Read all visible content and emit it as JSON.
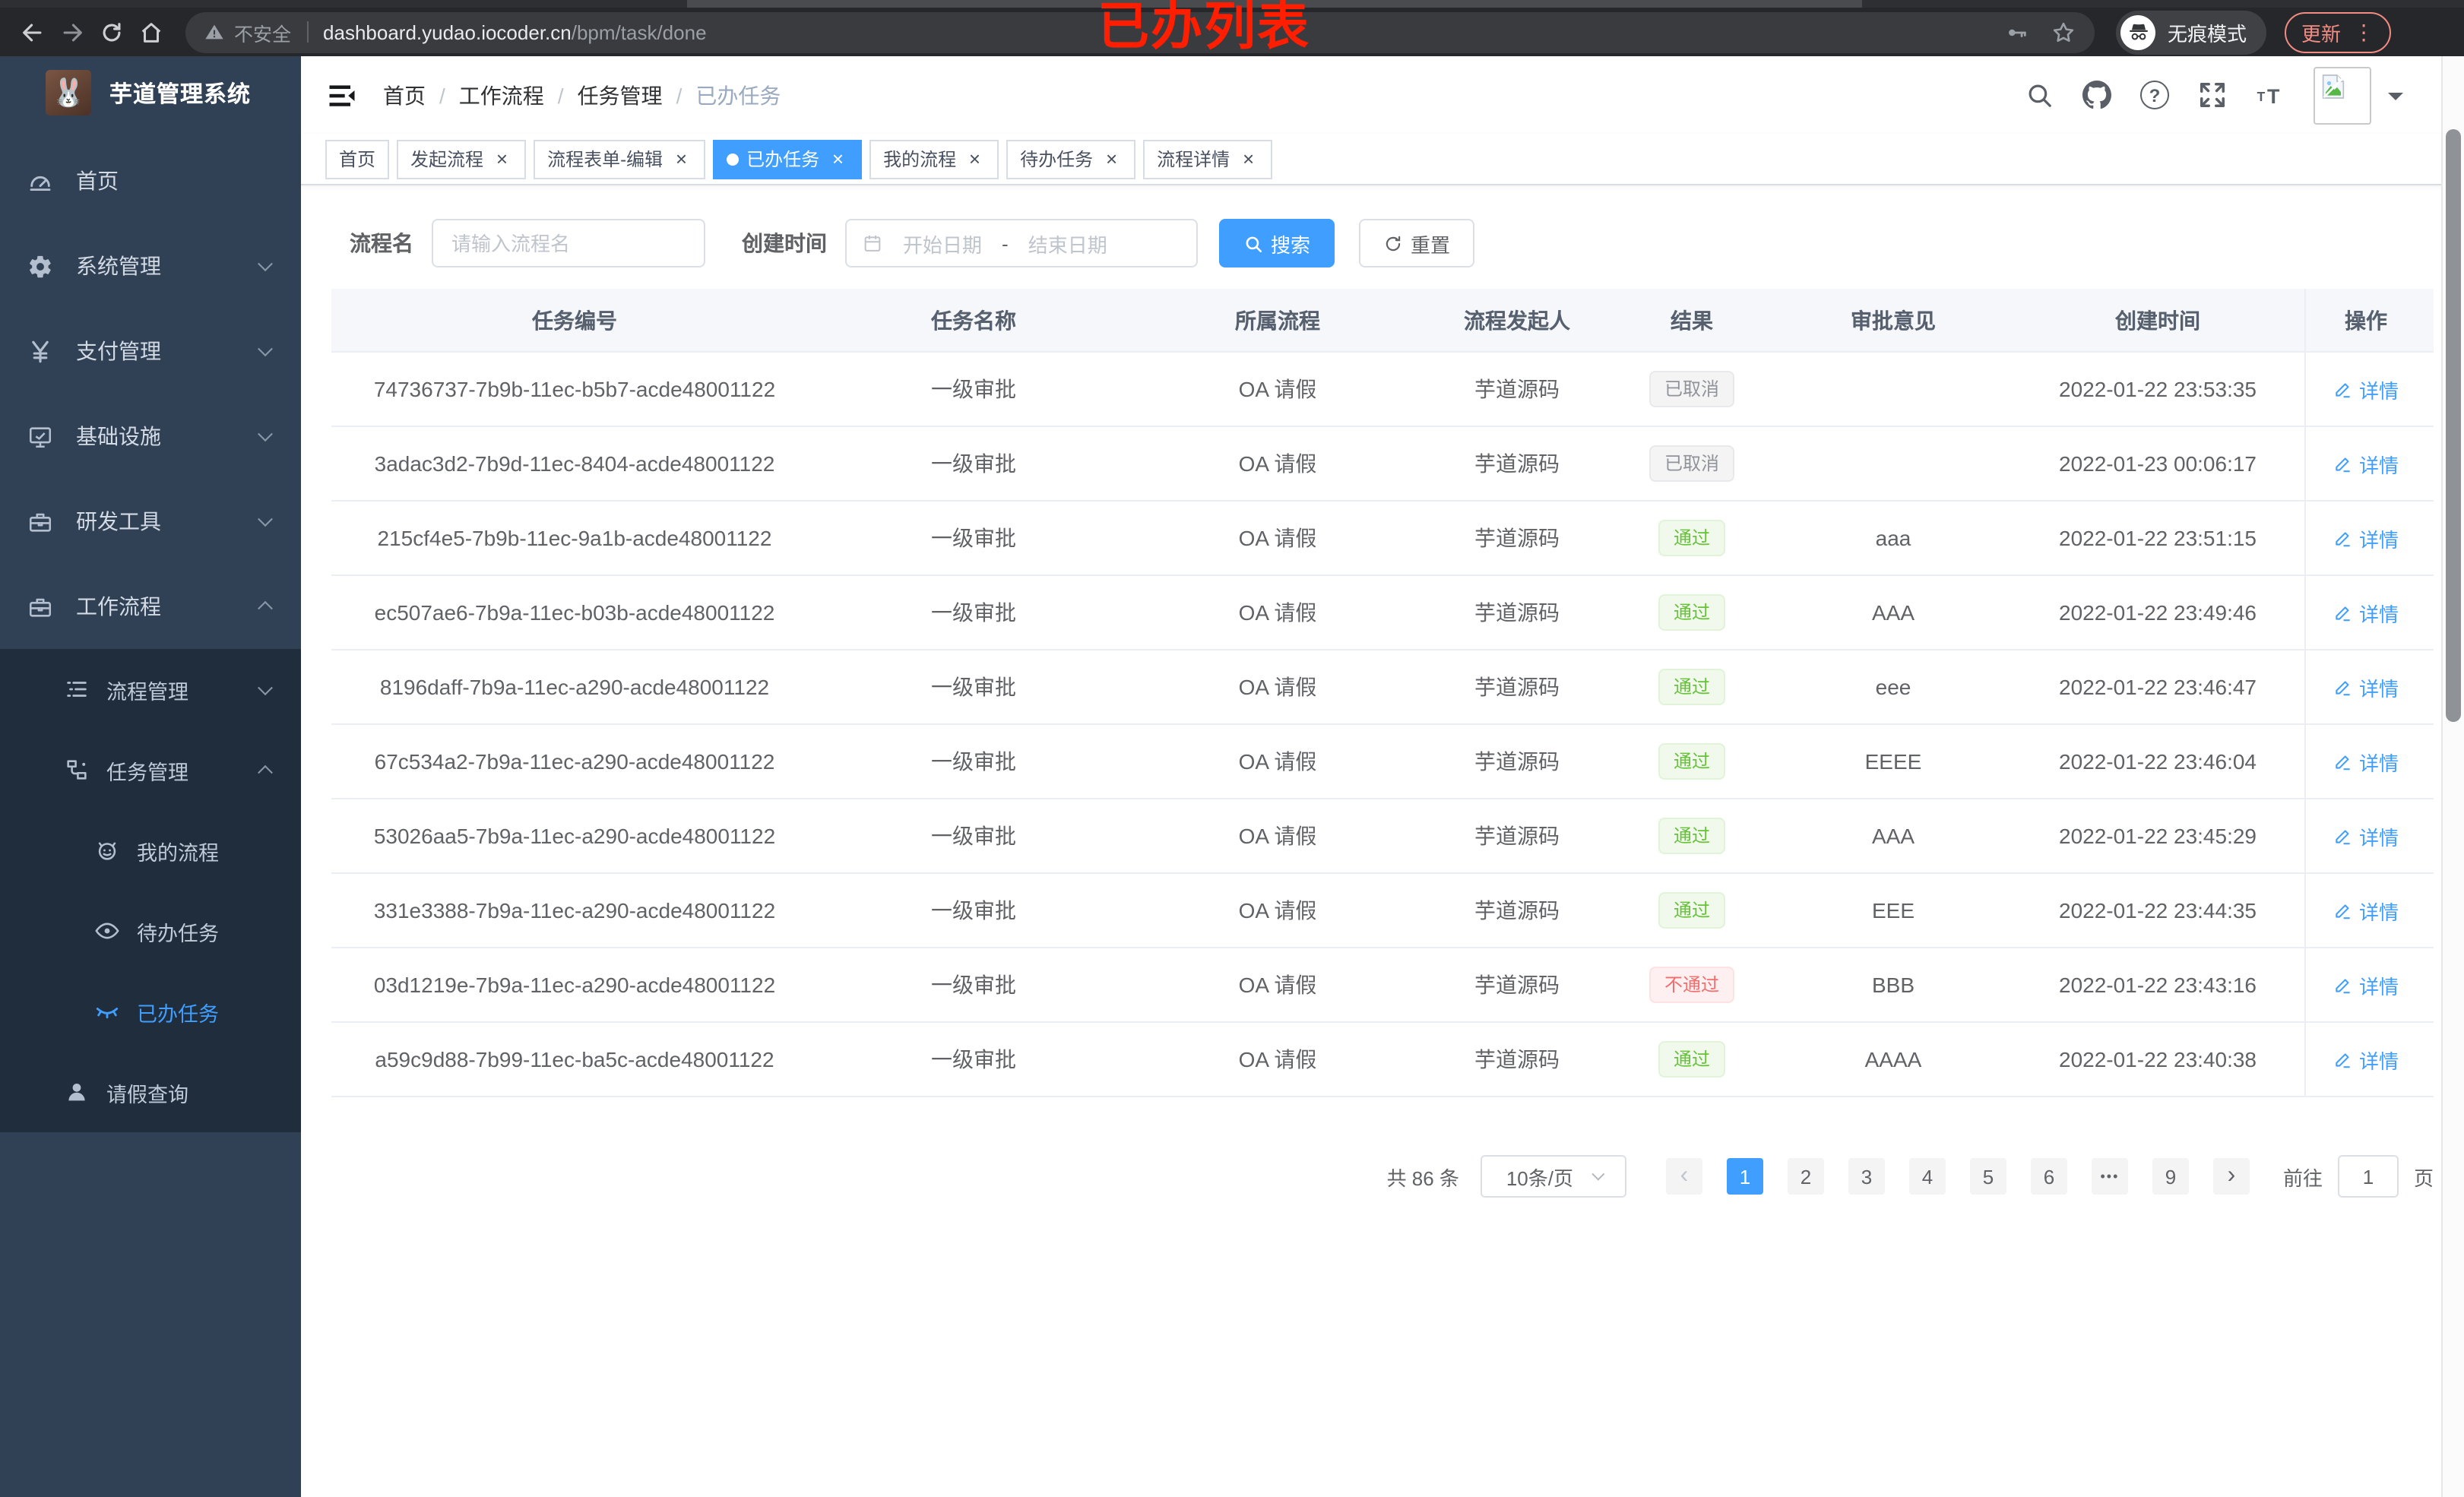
{
  "browser": {
    "security_label": "不安全",
    "url_host": "dashboard.yudao.iocoder.cn",
    "url_path": "/bpm/task/done",
    "incognito_label": "无痕模式",
    "update_label": "更新",
    "toolbar_icons": [
      "back-icon",
      "forward-icon",
      "reload-icon",
      "home-icon",
      "warning-icon",
      "key-icon",
      "star-icon",
      "incognito-icon",
      "menu-dots-icon"
    ]
  },
  "annotation": "已办列表",
  "sidebar": {
    "title": "芋道管理系统",
    "logo_icon": "rabbit-logo",
    "items": [
      {
        "label": "首页",
        "icon": "dashboard",
        "cls": "lvl1"
      },
      {
        "label": "系统管理",
        "icon": "gear",
        "cls": "lvl1",
        "arrow": "down"
      },
      {
        "label": "支付管理",
        "icon": "yen",
        "cls": "lvl1",
        "arrow": "down"
      },
      {
        "label": "基础设施",
        "icon": "monitor",
        "cls": "lvl1",
        "arrow": "down"
      },
      {
        "label": "研发工具",
        "icon": "toolbox",
        "cls": "lvl1",
        "arrow": "down"
      },
      {
        "label": "工作流程",
        "icon": "briefcase",
        "cls": "lvl1",
        "arrow": "up"
      },
      {
        "label": "流程管理",
        "icon": "list",
        "cls": "lvl2 dark",
        "arrow": "down"
      },
      {
        "label": "任务管理",
        "icon": "flow",
        "cls": "lvl2 dark",
        "arrow": "up"
      },
      {
        "label": "我的流程",
        "icon": "robot",
        "cls": "lvl3 dark"
      },
      {
        "label": "待办任务",
        "icon": "eye",
        "cls": "lvl3 dark"
      },
      {
        "label": "已办任务",
        "icon": "eye-closed",
        "cls": "lvl3 dark active"
      },
      {
        "label": "请假查询",
        "icon": "user",
        "cls": "lvl2 dark"
      }
    ]
  },
  "navbar": {
    "breadcrumb": [
      {
        "label": "首页",
        "sep": true
      },
      {
        "label": "工作流程",
        "sep": true
      },
      {
        "label": "任务管理",
        "sep": true
      },
      {
        "label": "已办任务",
        "cls": "current"
      }
    ],
    "icons": [
      "search-icon",
      "github-icon",
      "help-icon",
      "fullscreen-icon",
      "font-size-icon",
      "avatar",
      "caret-down-icon"
    ]
  },
  "tabs": [
    {
      "label": "首页"
    },
    {
      "label": "发起流程",
      "closable": true
    },
    {
      "label": "流程表单-编辑",
      "closable": true
    },
    {
      "label": "已办任务",
      "closable": true,
      "active": true,
      "cls": "active"
    },
    {
      "label": "我的流程",
      "closable": true
    },
    {
      "label": "待办任务",
      "closable": true
    },
    {
      "label": "流程详情",
      "closable": true
    }
  ],
  "filter": {
    "name_label": "流程名",
    "name_placeholder": "请输入流程名",
    "time_label": "创建时间",
    "start_placeholder": "开始日期",
    "range_separator": "-",
    "end_placeholder": "结束日期",
    "search_label": "搜索",
    "reset_label": "重置"
  },
  "table": {
    "headers": [
      "任务编号",
      "任务名称",
      "所属流程",
      "流程发起人",
      "结果",
      "审批意见",
      "创建时间",
      "操作"
    ],
    "action_label": "详情",
    "rows": [
      {
        "id": "74736737-7b9b-11ec-b5b7-acde48001122",
        "name": "一级审批",
        "process": "OA 请假",
        "starter": "芋道源码",
        "result": "已取消",
        "result_type": "info",
        "comment": "",
        "created": "2022-01-22 23:53:35"
      },
      {
        "id": "3adac3d2-7b9d-11ec-8404-acde48001122",
        "name": "一级审批",
        "process": "OA 请假",
        "starter": "芋道源码",
        "result": "已取消",
        "result_type": "info",
        "comment": "",
        "created": "2022-01-23 00:06:17"
      },
      {
        "id": "215cf4e5-7b9b-11ec-9a1b-acde48001122",
        "name": "一级审批",
        "process": "OA 请假",
        "starter": "芋道源码",
        "result": "通过",
        "result_type": "success",
        "comment": "aaa",
        "created": "2022-01-22 23:51:15"
      },
      {
        "id": "ec507ae6-7b9a-11ec-b03b-acde48001122",
        "name": "一级审批",
        "process": "OA 请假",
        "starter": "芋道源码",
        "result": "通过",
        "result_type": "success",
        "comment": "AAA",
        "created": "2022-01-22 23:49:46"
      },
      {
        "id": "8196daff-7b9a-11ec-a290-acde48001122",
        "name": "一级审批",
        "process": "OA 请假",
        "starter": "芋道源码",
        "result": "通过",
        "result_type": "success",
        "comment": "eee",
        "created": "2022-01-22 23:46:47"
      },
      {
        "id": "67c534a2-7b9a-11ec-a290-acde48001122",
        "name": "一级审批",
        "process": "OA 请假",
        "starter": "芋道源码",
        "result": "通过",
        "result_type": "success",
        "comment": "EEEE",
        "created": "2022-01-22 23:46:04"
      },
      {
        "id": "53026aa5-7b9a-11ec-a290-acde48001122",
        "name": "一级审批",
        "process": "OA 请假",
        "starter": "芋道源码",
        "result": "通过",
        "result_type": "success",
        "comment": "AAA",
        "created": "2022-01-22 23:45:29"
      },
      {
        "id": "331e3388-7b9a-11ec-a290-acde48001122",
        "name": "一级审批",
        "process": "OA 请假",
        "starter": "芋道源码",
        "result": "通过",
        "result_type": "success",
        "comment": "EEE",
        "created": "2022-01-22 23:44:35"
      },
      {
        "id": "03d1219e-7b9a-11ec-a290-acde48001122",
        "name": "一级审批",
        "process": "OA 请假",
        "starter": "芋道源码",
        "result": "不通过",
        "result_type": "danger",
        "comment": "BBB",
        "created": "2022-01-22 23:43:16"
      },
      {
        "id": "a59c9d88-7b99-11ec-ba5c-acde48001122",
        "name": "一级审批",
        "process": "OA 请假",
        "starter": "芋道源码",
        "result": "通过",
        "result_type": "success",
        "comment": "AAAA",
        "created": "2022-01-22 23:40:38"
      }
    ]
  },
  "pagination": {
    "total_label": "共 86 条",
    "page_size": "10条/页",
    "prev": "‹",
    "next": "›",
    "pages": [
      {
        "label": "1",
        "cls": "active"
      },
      {
        "label": "2"
      },
      {
        "label": "3"
      },
      {
        "label": "4"
      },
      {
        "label": "5"
      },
      {
        "label": "6"
      },
      {
        "label": "•••",
        "cls": "more"
      },
      {
        "label": "9"
      }
    ],
    "goto_label": "前往",
    "goto_value": "1",
    "unit_label": "页"
  },
  "colors": {
    "accent": "#409eff",
    "success": "#67c23a",
    "danger": "#f56c6c",
    "info": "#909399",
    "sidebar_bg": "#304156",
    "submenu_bg": "#1f2d3d",
    "annotation_red": "#ff1e00",
    "update_salmon": "#f28b82"
  }
}
